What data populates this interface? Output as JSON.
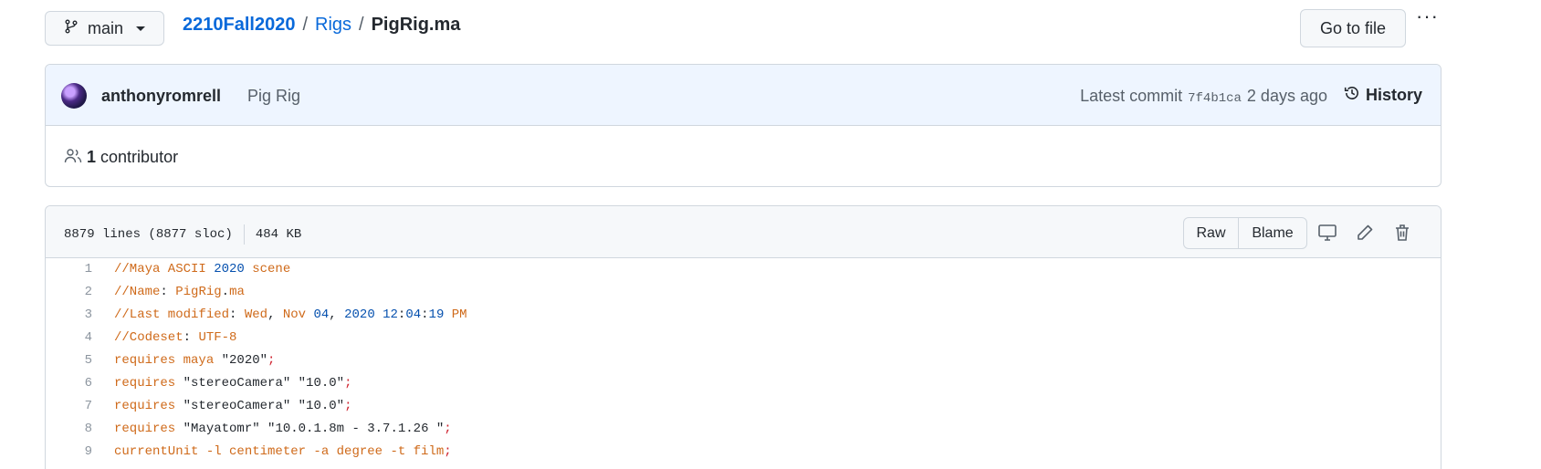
{
  "branch": {
    "name": "main"
  },
  "breadcrumb": {
    "repo": "2210Fall2020",
    "sep1": "/",
    "folder": "Rigs",
    "sep2": "/",
    "file": "PigRig.ma"
  },
  "actions": {
    "goto_file": "Go to file",
    "more": "···"
  },
  "commit": {
    "author": "anthonyromrell",
    "message": "Pig Rig",
    "latest_label": "Latest commit",
    "sha": "7f4b1ca",
    "time": "2 days ago",
    "history_label": "History"
  },
  "contributors": {
    "count": "1",
    "label": "contributor"
  },
  "file": {
    "lines": "8879 lines (8877 sloc)",
    "size": "484 KB",
    "raw_label": "Raw",
    "blame_label": "Blame"
  },
  "icons": {
    "branch": "git-branch-icon",
    "history": "history-clock-icon",
    "people": "people-icon",
    "desktop": "desktop-icon",
    "edit": "pencil-icon",
    "delete": "trash-icon"
  },
  "code_lines": [
    {
      "n": "1",
      "parts": [
        [
          "c-com",
          "//Maya ASCII "
        ],
        [
          "c-num",
          "2020"
        ],
        [
          "c-com",
          " scene"
        ]
      ]
    },
    {
      "n": "2",
      "parts": [
        [
          "c-com",
          "//Name"
        ],
        [
          "c-str",
          ": "
        ],
        [
          "c-com",
          "PigRig"
        ],
        [
          "c-str",
          "."
        ],
        [
          "c-com",
          "ma"
        ]
      ]
    },
    {
      "n": "3",
      "parts": [
        [
          "c-com",
          "//Last modified"
        ],
        [
          "c-str",
          ": "
        ],
        [
          "c-com",
          "Wed"
        ],
        [
          "c-str",
          ", "
        ],
        [
          "c-com",
          "Nov "
        ],
        [
          "c-num",
          "04"
        ],
        [
          "c-str",
          ", "
        ],
        [
          "c-num",
          "2020 12"
        ],
        [
          "c-str",
          ":"
        ],
        [
          "c-num",
          "04"
        ],
        [
          "c-str",
          ":"
        ],
        [
          "c-num",
          "19"
        ],
        [
          "c-com",
          " PM"
        ]
      ]
    },
    {
      "n": "4",
      "parts": [
        [
          "c-com",
          "//Codeset"
        ],
        [
          "c-str",
          ": "
        ],
        [
          "c-com",
          "UTF-8"
        ]
      ]
    },
    {
      "n": "5",
      "parts": [
        [
          "c-kw",
          "requires maya "
        ],
        [
          "c-str",
          "\"2020\""
        ],
        [
          "c-punct",
          ";"
        ]
      ]
    },
    {
      "n": "6",
      "parts": [
        [
          "c-kw",
          "requires "
        ],
        [
          "c-str",
          "\"stereoCamera\" \"10.0\""
        ],
        [
          "c-punct",
          ";"
        ]
      ]
    },
    {
      "n": "7",
      "parts": [
        [
          "c-kw",
          "requires "
        ],
        [
          "c-str",
          "\"stereoCamera\" \"10.0\""
        ],
        [
          "c-punct",
          ";"
        ]
      ]
    },
    {
      "n": "8",
      "parts": [
        [
          "c-kw",
          "requires "
        ],
        [
          "c-str",
          "\"Mayatomr\" \"10.0.1.8m - 3.7.1.26 \""
        ],
        [
          "c-punct",
          ";"
        ]
      ]
    },
    {
      "n": "9",
      "parts": [
        [
          "c-kw",
          "currentUnit -l centimeter -a degree -t film"
        ],
        [
          "c-punct",
          ";"
        ]
      ]
    }
  ]
}
